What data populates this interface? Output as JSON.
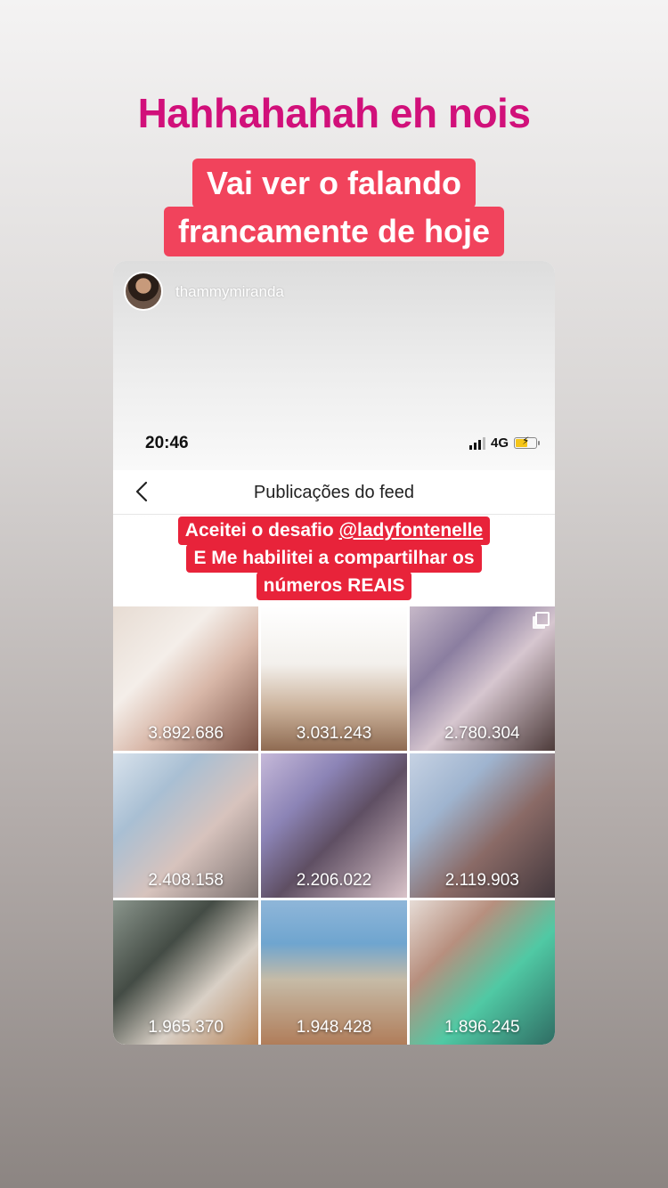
{
  "story": {
    "headline": "Hahhahahah eh nois",
    "caption_lines": [
      "Vai ver o falando",
      "francamente de hoje"
    ]
  },
  "post": {
    "username": "thammymiranda"
  },
  "status_bar": {
    "time": "20:46",
    "network": "4G"
  },
  "nav": {
    "title": "Publicações do feed"
  },
  "overlay_caption": {
    "line1_prefix": "Aceitei o desafio ",
    "mention": "@ladyfontenelle",
    "line2": "E Me habilitei a compartilhar os",
    "line3": "números REAIS"
  },
  "grid": {
    "tiles": [
      {
        "count": "3.892.686"
      },
      {
        "count": "3.031.243"
      },
      {
        "count": "2.780.304"
      },
      {
        "count": "2.408.158"
      },
      {
        "count": "2.206.022"
      },
      {
        "count": "2.119.903"
      },
      {
        "count": "1.965.370"
      },
      {
        "count": "1.948.428"
      },
      {
        "count": "1.896.245"
      }
    ]
  },
  "icons": {
    "back": "chevron-left-icon",
    "signal": "signal-bars-icon",
    "battery": "battery-charging-icon",
    "multi": "carousel-icon"
  },
  "colors": {
    "headline": "#d1107a",
    "caption_bg": "#f1435c",
    "overlay_bg": "#e8233a"
  }
}
